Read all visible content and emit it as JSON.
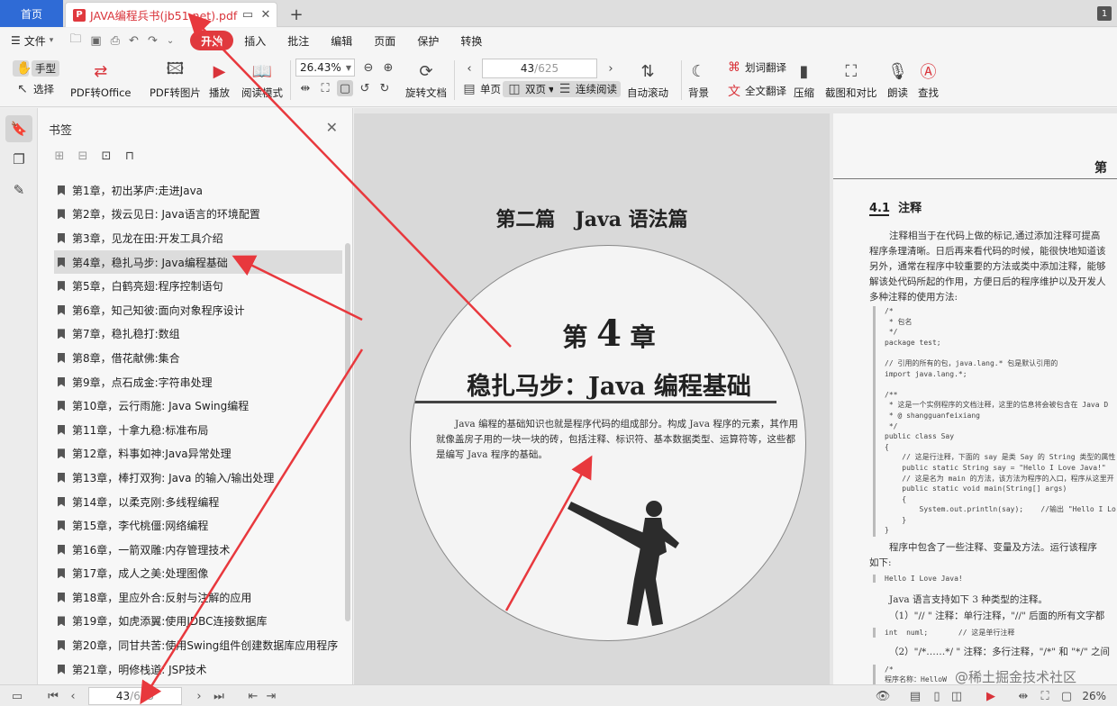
{
  "tabs": {
    "home": "首页",
    "document_title": "JAVA编程兵书(jb51.net).pdf",
    "new_tab": "+",
    "tab_count": "1"
  },
  "menubar": {
    "file": "文件",
    "items": [
      "开始",
      "插入",
      "批注",
      "编辑",
      "页面",
      "保护",
      "转换"
    ],
    "active": "开始"
  },
  "toolbar": {
    "hand": "手型",
    "select": "选择",
    "pdf_to_office": "PDF转Office",
    "pdf_to_image": "PDF转图片",
    "play": "播放",
    "read_mode": "阅读模式",
    "zoom_value": "26.43%",
    "rotate": "旋转文档",
    "page_current": "43",
    "page_total": "/625",
    "single": "单页",
    "double": "双页",
    "continuous": "连续阅读",
    "auto_scroll": "自动滚动",
    "background": "背景",
    "word_translate": "划词翻译",
    "full_translate": "全文翻译",
    "compress": "压缩",
    "screenshot_compare": "截图和对比",
    "read_aloud": "朗读",
    "find": "查找"
  },
  "panel": {
    "title": "书签",
    "bookmarks": [
      "第1章，初出茅庐:走进Java",
      "第2章，拨云见日: Java语言的环境配置",
      "第3章，见龙在田:开发工具介绍",
      "第4章，稳扎马步: Java编程基础",
      "第5章，白鹤亮翅:程序控制语句",
      "第6章，知己知彼:面向对象程序设计",
      "第7章，稳扎稳打:数组",
      "第8章，借花献佛:集合",
      "第9章，点石成金:字符串处理",
      "第10章，云行雨施: Java Swing编程",
      "第11章，十拿九稳:标准布局",
      "第12章，料事如神:Java异常处理",
      "第13章，棒打双狗: Java 的输入/输出处理",
      "第14章，以柔克刚:多线程编程",
      "第15章，李代桃僵:网络编程",
      "第16章，一箭双雕:内存管理技术",
      "第17章，成人之美:处理图像",
      "第18章，里应外合:反射与注解的应用",
      "第19章，如虎添翼:使用JDBC连接数据库",
      "第20章，同甘共苦:使用Swing组件创建数据库应用程序",
      "第21章，明修栈道: JSP技术"
    ],
    "selected_index": 3
  },
  "page_left": {
    "part_title": "第二篇　Java 语法篇",
    "chapter_prefix": "第",
    "chapter_number": "4",
    "chapter_suffix": "章",
    "chapter_title": "稳扎马步：Java 编程基础",
    "intro": "Java 编程的基础知识也就是程序代码的组成部分。构成 Java 程序的元素，其作用就像盖房子用的一块一块的砖，包括注释、标识符、基本数据类型、运算符等，这些都是编写 Java 程序的基础。"
  },
  "page_right": {
    "header": "第",
    "section_num": "4.1",
    "section_title": "注释",
    "para1": [
      "注释相当于在代码上做的标记,通过添加注释可提高",
      "程序条理清晰。日后再来看代码的时候，能很快地知道该",
      "另外，通常在程序中较重要的方法或类中添加注释，能够",
      "解该处代码所起的作用，方便日后的程序维护以及开发人",
      "多种注释的使用方法:"
    ],
    "code": "/*\n * 包名\n */\npackage test;\n\n// 引用的所有的包，java.lang.* 包是默认引用的\nimport java.lang.*;\n\n/**\n * 这是一个实例程序的文档注释，这里的信息将会被包含在 Java D\n * @ shangguanfeixiang\n */\npublic class Say\n{\n    // 这是行注释，下面的 say 是类 Say 的 String 类型的属性\n    public static String say = \"Hello I Love Java!\"\n    // 这是名为 main 的方法，该方法为程序的入口，程序从这里开\n    public static void main(String[] args)\n    {\n        System.out.println(say);    //输出 \"Hello I Lo\n    }\n}",
    "para2": "程序中包含了一些注释、变量及方法。运行该程序",
    "para2b": "如下:",
    "output": "Hello I Love Java!",
    "para3": "Java 语言支持如下 3 种类型的注释。",
    "para4": "（1）\"// \" 注释：单行注释，\"//\" 后面的所有文字都",
    "code2": "int  numl;       // 这是单行注释",
    "para5": "（2）\"/*……*/ \" 注释：多行注释，\"/*\" 和 \"*/\" 之间",
    "code3": "/*\n程序名称：HelloW"
  },
  "statusbar": {
    "page_current": "43",
    "page_total": "/625",
    "zoom": "26%",
    "watermark": "@稀土掘金技术社区"
  },
  "colors": {
    "accent_red": "#e0393e",
    "home_blue": "#2f6bd6",
    "annotation_arrow": "#e8383d"
  }
}
